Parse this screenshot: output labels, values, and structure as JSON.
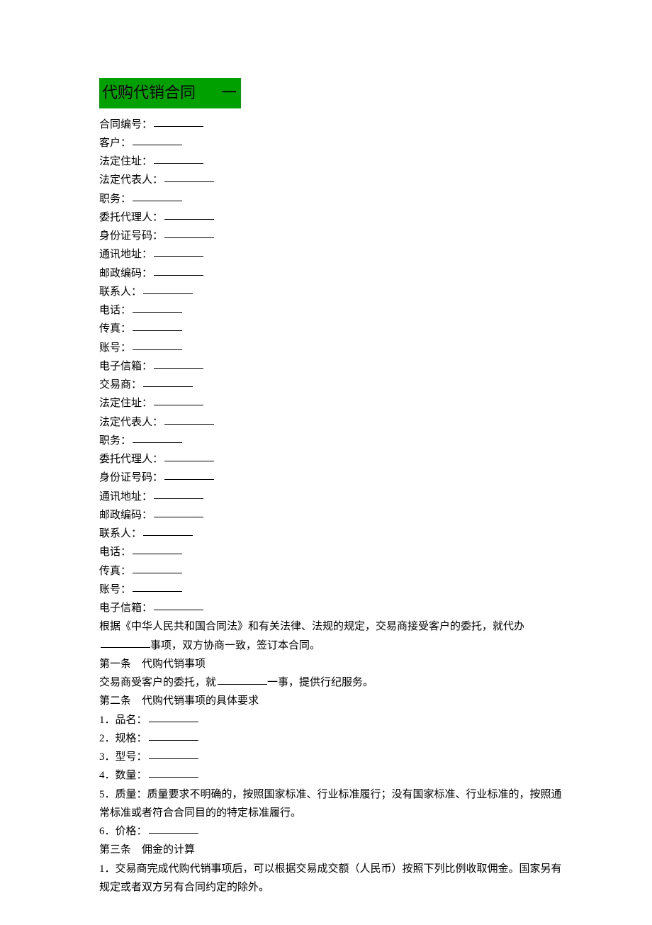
{
  "title_main": "代购代销合同",
  "title_suffix": "一",
  "customer_fields": [
    "合同编号：",
    "客户：",
    "法定住址：",
    "法定代表人：",
    "职务：",
    "委托代理人：",
    "身份证号码：",
    "通讯地址：",
    "邮政编码：",
    "联系人：",
    "电话：",
    "传真：",
    "账号：",
    "电子信箱：",
    "交易商：",
    "法定住址：",
    "法定代表人：",
    "职务：",
    "委托代理人：",
    "身份证号码：",
    "通讯地址：",
    "邮政编码：",
    "联系人：",
    "电话：",
    "传真：",
    "账号：",
    "电子信箱："
  ],
  "preamble_before": "根据《中华人民共和国合同法》和有关法律、法规的规定，交易商接受客户的委托，就代办",
  "preamble_after": "事项，双方协商一致，签订本合同。",
  "article1_title": "第一条　代购代销事项",
  "article1_before": "交易商受客户的委托，就",
  "article1_after": "一事，提供行纪服务。",
  "article2_title": "第二条　代购代销事项的具体要求",
  "article2_items": [
    "1．品名：",
    "2．规格：",
    "3．型号：",
    "4．数量："
  ],
  "article2_item5": "5．质量：质量要求不明确的，按照国家标准、行业标准履行；没有国家标准、行业标准的，按照通常标准或者符合合同目的的特定标准履行。",
  "article2_item6": "6．价格：",
  "article3_title": "第三条　佣金的计算",
  "article3_item1": "1．交易商完成代购代销事项后，可以根据交易成交额（人民币）按照下列比例收取佣金。国家另有规定或者双方另有合同约定的除外。"
}
